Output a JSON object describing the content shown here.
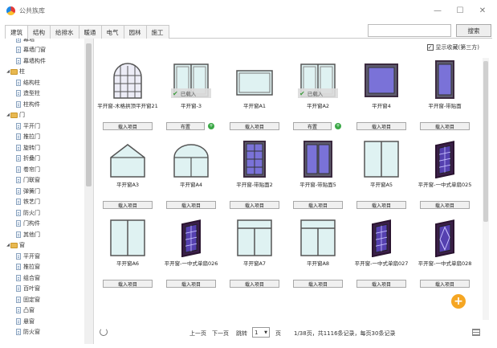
{
  "window": {
    "title": "公共族库",
    "controls": [
      "—",
      "☐",
      "✕"
    ]
  },
  "tabs": [
    "建筑",
    "结构",
    "给排水",
    "暖通",
    "电气",
    "园林",
    "施工"
  ],
  "search": {
    "value": "",
    "button": "搜索"
  },
  "tree": [
    {
      "label": "幕墙",
      "type": "doc",
      "level": 2
    },
    {
      "label": "幕墙门窗",
      "type": "doc",
      "level": 2
    },
    {
      "label": "幕墙构件",
      "type": "doc",
      "level": 2
    },
    {
      "label": "柱",
      "type": "folder",
      "level": 1
    },
    {
      "label": "结构柱",
      "type": "doc",
      "level": 2
    },
    {
      "label": "造型柱",
      "type": "doc",
      "level": 2
    },
    {
      "label": "柱构件",
      "type": "doc",
      "level": 2
    },
    {
      "label": "门",
      "type": "folder",
      "level": 1
    },
    {
      "label": "平开门",
      "type": "doc",
      "level": 2
    },
    {
      "label": "推拉门",
      "type": "doc",
      "level": 2
    },
    {
      "label": "旋转门",
      "type": "doc",
      "level": 2
    },
    {
      "label": "折叠门",
      "type": "doc",
      "level": 2
    },
    {
      "label": "卷帘门",
      "type": "doc",
      "level": 2
    },
    {
      "label": "门联窗",
      "type": "doc",
      "level": 2
    },
    {
      "label": "弹簧门",
      "type": "doc",
      "level": 2
    },
    {
      "label": "铁艺门",
      "type": "doc",
      "level": 2
    },
    {
      "label": "防火门",
      "type": "doc",
      "level": 2
    },
    {
      "label": "门构件",
      "type": "doc",
      "level": 2
    },
    {
      "label": "其他门",
      "type": "doc",
      "level": 2
    },
    {
      "label": "窗",
      "type": "folder",
      "level": 1
    },
    {
      "label": "平开窗",
      "type": "doc",
      "level": 2
    },
    {
      "label": "推拉窗",
      "type": "doc",
      "level": 2
    },
    {
      "label": "组合窗",
      "type": "doc",
      "level": 2
    },
    {
      "label": "百叶窗",
      "type": "doc",
      "level": 2
    },
    {
      "label": "固定窗",
      "type": "doc",
      "level": 2
    },
    {
      "label": "凸窗",
      "type": "doc",
      "level": 2
    },
    {
      "label": "悬窗",
      "type": "doc",
      "level": 2
    },
    {
      "label": "防火窗",
      "type": "doc",
      "level": 2
    }
  ],
  "show_favorites": {
    "label": "显示收藏(第三方)",
    "checked": true
  },
  "loaded_label": "已载入",
  "items": [
    {
      "name": "平开窗-木格拱顶平开窗21",
      "button": "载入项目",
      "style": "arch-grid",
      "loaded": false
    },
    {
      "name": "平开窗-3",
      "button": "布置",
      "style": "double",
      "loaded": true
    },
    {
      "name": "平开窗A1",
      "button": "载入项目",
      "style": "single",
      "loaded": false
    },
    {
      "name": "平开窗A2",
      "button": "布置",
      "style": "double",
      "loaded": true
    },
    {
      "name": "平开窗4",
      "button": "载入项目",
      "style": "purple-single",
      "loaded": false
    },
    {
      "name": "平开窗-带贴面",
      "button": "载入项目",
      "style": "purple-narrow",
      "loaded": false
    },
    {
      "name": "平开窗A3",
      "button": "载入项目",
      "style": "pent",
      "loaded": false
    },
    {
      "name": "平开窗A4",
      "button": "载入项目",
      "style": "arch",
      "loaded": false
    },
    {
      "name": "平开窗-带贴面2",
      "button": "载入项目",
      "style": "purple-grid",
      "loaded": false
    },
    {
      "name": "平开窗-带贴面5",
      "button": "载入项目",
      "style": "purple-double",
      "loaded": false
    },
    {
      "name": "平开窗A5",
      "button": "载入项目",
      "style": "double-tall",
      "loaded": false
    },
    {
      "name": "平开窗-一中式单扇025",
      "button": "载入项目",
      "style": "chinese",
      "loaded": false
    },
    {
      "name": "平开窗A6",
      "button": "载入项目",
      "style": "double-tall",
      "loaded": false
    },
    {
      "name": "平开窗-一中式单扇026",
      "button": "载入项目",
      "style": "chinese",
      "loaded": false
    },
    {
      "name": "平开窗A7",
      "button": "载入项目",
      "style": "transom",
      "loaded": false
    },
    {
      "name": "平开窗A8",
      "button": "载入项目",
      "style": "transom",
      "loaded": false
    },
    {
      "name": "平开窗-一中式单扇027",
      "button": "载入项目",
      "style": "chinese-narrow",
      "loaded": false
    },
    {
      "name": "平开窗-一中式单扇028",
      "button": "载入项目",
      "style": "chinese-diamond",
      "loaded": false
    }
  ],
  "pager": {
    "prev": "上一页",
    "next": "下一页",
    "jump": "跳转",
    "page_value": "1",
    "page_unit": "页",
    "summary": "1/38页，共1116条记录，每页30条记录"
  }
}
